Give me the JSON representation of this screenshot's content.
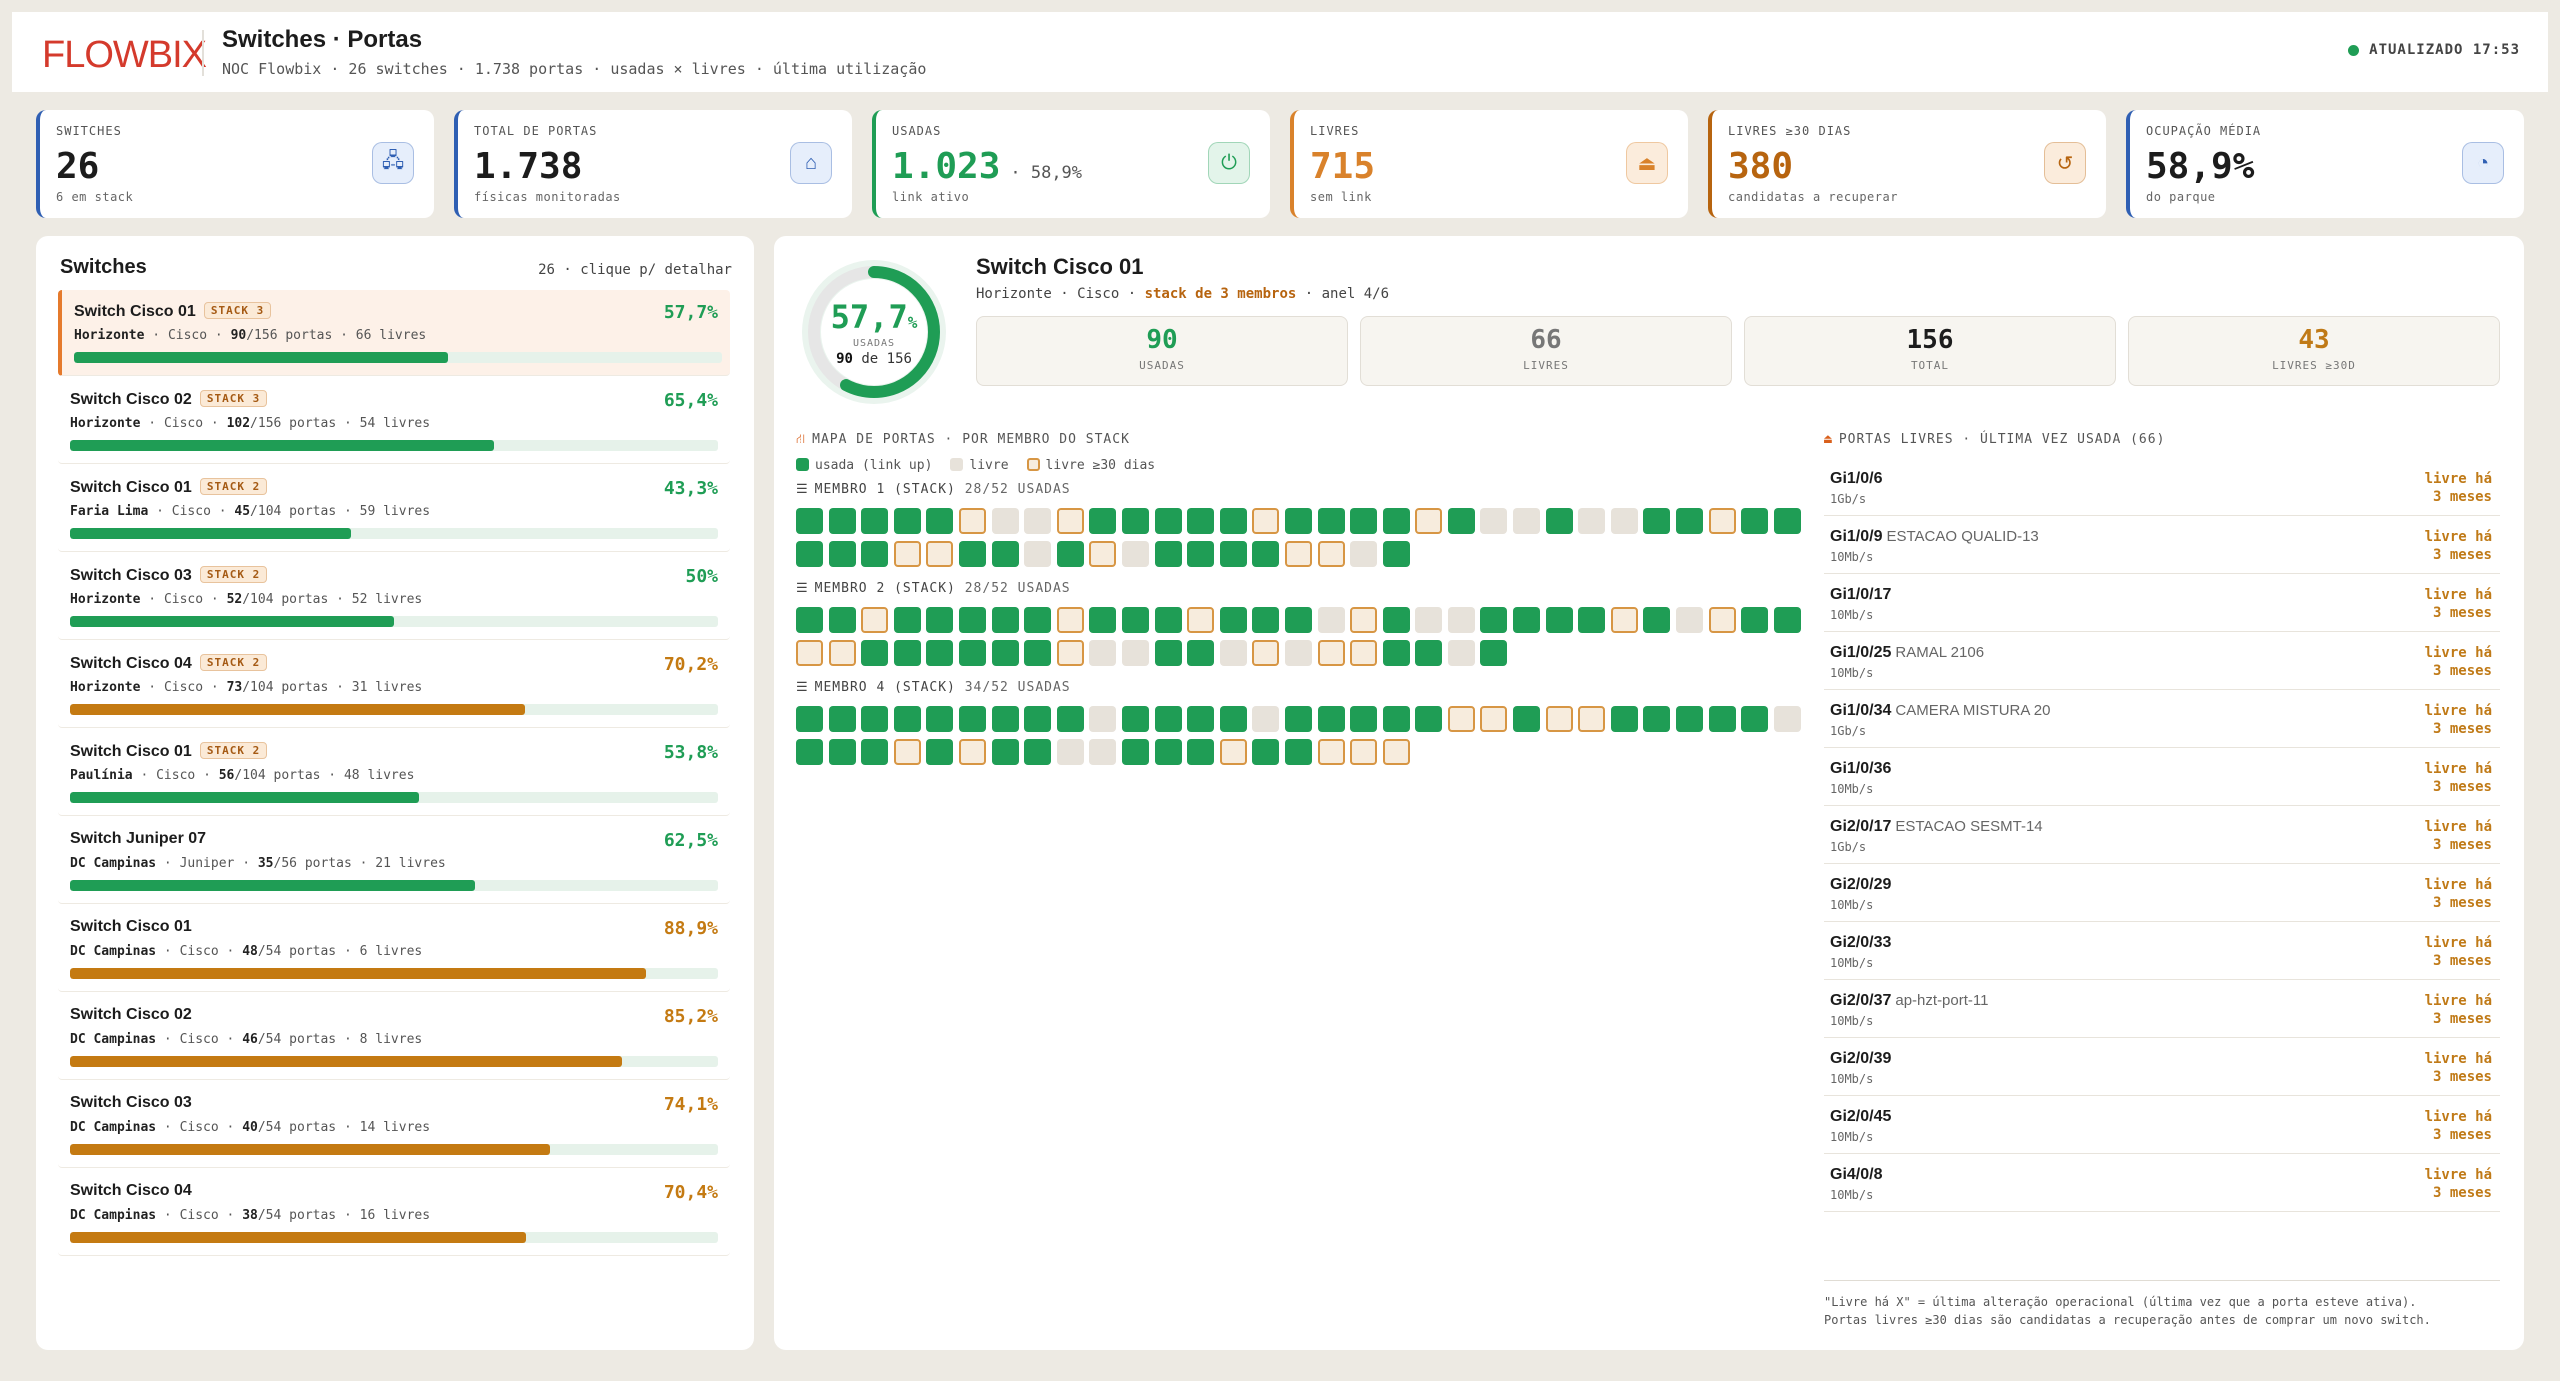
{
  "header": {
    "logo": "FLOWBIX",
    "title": "Switches · Portas",
    "subtitle": "NOC Flowbix · 26 switches · 1.738 portas · usadas × livres · última utilização",
    "updated": "ATUALIZADO 17:53"
  },
  "kpis": [
    {
      "label": "SWITCHES",
      "value": "26",
      "extra": "",
      "sub": "6 em stack",
      "icon": "network-icon",
      "color": "#2f5fb3"
    },
    {
      "label": "TOTAL DE PORTAS",
      "value": "1.738",
      "extra": "",
      "sub": "físicas monitoradas",
      "icon": "ethernet-port-icon",
      "color": "#2f5fb3"
    },
    {
      "label": "USADAS",
      "value": "1.023",
      "extra": "· 58,9%",
      "sub": "link ativo",
      "icon": "plug-icon",
      "color": "#1f9d55"
    },
    {
      "label": "LIVRES",
      "value": "715",
      "extra": "",
      "sub": "sem link",
      "icon": "unplugged-icon",
      "color": "#d9822b"
    },
    {
      "label": "LIVRES ≥30 DIAS",
      "value": "380",
      "extra": "",
      "sub": "candidatas a recuperar",
      "icon": "history-icon",
      "color": "#b7640f"
    },
    {
      "label": "OCUPAÇÃO MÉDIA",
      "value": "58,9%",
      "extra": "",
      "sub": "do parque",
      "icon": "gauge-icon",
      "color": "#2f5fb3"
    }
  ],
  "switch_list": {
    "title": "Switches",
    "hint": "26 · clique p/ detalhar",
    "items": [
      {
        "name": "Switch Cisco 01",
        "stack": "STACK 3",
        "site": "Horizonte",
        "vendor": "Cisco",
        "used": "90",
        "total": "/156 portas",
        "free": "66 livres",
        "pct": "57,7%",
        "fill": 0.577,
        "color": "#1f9d55"
      },
      {
        "name": "Switch Cisco 02",
        "stack": "STACK 3",
        "site": "Horizonte",
        "vendor": "Cisco",
        "used": "102",
        "total": "/156 portas",
        "free": "54 livres",
        "pct": "65,4%",
        "fill": 0.654,
        "color": "#1f9d55"
      },
      {
        "name": "Switch Cisco 01",
        "stack": "STACK 2",
        "site": "Faria Lima",
        "vendor": "Cisco",
        "used": "45",
        "total": "/104 portas",
        "free": "59 livres",
        "pct": "43,3%",
        "fill": 0.433,
        "color": "#1f9d55"
      },
      {
        "name": "Switch Cisco 03",
        "stack": "STACK 2",
        "site": "Horizonte",
        "vendor": "Cisco",
        "used": "52",
        "total": "/104 portas",
        "free": "52 livres",
        "pct": "50%",
        "fill": 0.5,
        "color": "#1f9d55"
      },
      {
        "name": "Switch Cisco 04",
        "stack": "STACK 2",
        "site": "Horizonte",
        "vendor": "Cisco",
        "used": "73",
        "total": "/104 portas",
        "free": "31 livres",
        "pct": "70,2%",
        "fill": 0.702,
        "color": "#c47a12"
      },
      {
        "name": "Switch Cisco 01",
        "stack": "STACK 2",
        "site": "Paulínia",
        "vendor": "Cisco",
        "used": "56",
        "total": "/104 portas",
        "free": "48 livres",
        "pct": "53,8%",
        "fill": 0.538,
        "color": "#1f9d55"
      },
      {
        "name": "Switch Juniper 07",
        "stack": "",
        "site": "DC Campinas",
        "vendor": "Juniper",
        "used": "35",
        "total": "/56 portas",
        "free": "21 livres",
        "pct": "62,5%",
        "fill": 0.625,
        "color": "#1f9d55"
      },
      {
        "name": "Switch Cisco 01",
        "stack": "",
        "site": "DC Campinas",
        "vendor": "Cisco",
        "used": "48",
        "total": "/54 portas",
        "free": "6 livres",
        "pct": "88,9%",
        "fill": 0.889,
        "color": "#c47a12"
      },
      {
        "name": "Switch Cisco 02",
        "stack": "",
        "site": "DC Campinas",
        "vendor": "Cisco",
        "used": "46",
        "total": "/54 portas",
        "free": "8 livres",
        "pct": "85,2%",
        "fill": 0.852,
        "color": "#c47a12"
      },
      {
        "name": "Switch Cisco 03",
        "stack": "",
        "site": "DC Campinas",
        "vendor": "Cisco",
        "used": "40",
        "total": "/54 portas",
        "free": "14 livres",
        "pct": "74,1%",
        "fill": 0.741,
        "color": "#c47a12"
      },
      {
        "name": "Switch Cisco 04",
        "stack": "",
        "site": "DC Campinas",
        "vendor": "Cisco",
        "used": "38",
        "total": "/54 portas",
        "free": "16 livres",
        "pct": "70,4%",
        "fill": 0.704,
        "color": "#c47a12"
      }
    ]
  },
  "detail": {
    "donut_pct": "57,7",
    "donut_pct_unit": "%",
    "donut_fill": 0.577,
    "donut_label": "USADAS",
    "donut_used": "90",
    "donut_of": "de 156",
    "title": "Switch Cisco 01",
    "meta_prefix": "Horizonte · Cisco · ",
    "meta_stack": "stack de 3 membros",
    "meta_suffix": " · anel 4/6",
    "stats": [
      {
        "value": "90",
        "label": "USADAS",
        "color": "#1f9d55"
      },
      {
        "value": "66",
        "label": "LIVRES",
        "color": "#777777"
      },
      {
        "value": "156",
        "label": "TOTAL",
        "color": "#1c1c1c"
      },
      {
        "value": "43",
        "label": "LIVRES ≥30D",
        "color": "#c07a17"
      }
    ],
    "map_title": "MAPA DE PORTAS · POR MEMBRO DO STACK",
    "legend": {
      "used": "usada (link up)",
      "free": "livre",
      "old": "livre ≥30 dias"
    },
    "members": [
      {
        "label": "MEMBRO 1 (STACK)",
        "used": "28/52 USADAS",
        "ports": "UUUUUOFFOUUUUUOUUUUOUFFUFFUUOUUUUUOOUUFUOFUUUUOOFU"
      },
      {
        "label": "MEMBRO 2 (STACK)",
        "used": "28/52 USADAS",
        "ports": "UUOUUUUUOUUUOUUUFOUFFUUUUOUFOUUOOUUUUUUOFFUUFOFOOUUFU"
      },
      {
        "label": "MEMBRO 4 (STACK)",
        "used": "34/52 USADAS",
        "ports": "UUUUUUUUUFUUUUFUUUUUOOUOOUUUUUFUUUOUOUUFFUUUOUUOOO"
      }
    ],
    "free_title": "PORTAS LIVRES · ÚLTIMA VEZ USADA (66)",
    "free_ports": [
      {
        "port": "Gi1/0/6",
        "desc": "",
        "speed": "1Gb/s",
        "age1": "livre há",
        "age2": "3 meses"
      },
      {
        "port": "Gi1/0/9",
        "desc": "ESTACAO QUALID-13",
        "speed": "10Mb/s",
        "age1": "livre há",
        "age2": "3 meses"
      },
      {
        "port": "Gi1/0/17",
        "desc": "",
        "speed": "10Mb/s",
        "age1": "livre há",
        "age2": "3 meses"
      },
      {
        "port": "Gi1/0/25",
        "desc": "RAMAL 2106",
        "speed": "10Mb/s",
        "age1": "livre há",
        "age2": "3 meses"
      },
      {
        "port": "Gi1/0/34",
        "desc": "CAMERA MISTURA 20",
        "speed": "1Gb/s",
        "age1": "livre há",
        "age2": "3 meses"
      },
      {
        "port": "Gi1/0/36",
        "desc": "",
        "speed": "10Mb/s",
        "age1": "livre há",
        "age2": "3 meses"
      },
      {
        "port": "Gi2/0/17",
        "desc": "ESTACAO SESMT-14",
        "speed": "1Gb/s",
        "age1": "livre há",
        "age2": "3 meses"
      },
      {
        "port": "Gi2/0/29",
        "desc": "",
        "speed": "10Mb/s",
        "age1": "livre há",
        "age2": "3 meses"
      },
      {
        "port": "Gi2/0/33",
        "desc": "",
        "speed": "10Mb/s",
        "age1": "livre há",
        "age2": "3 meses"
      },
      {
        "port": "Gi2/0/37",
        "desc": "ap-hzt-port-11",
        "speed": "10Mb/s",
        "age1": "livre há",
        "age2": "3 meses"
      },
      {
        "port": "Gi2/0/39",
        "desc": "",
        "speed": "10Mb/s",
        "age1": "livre há",
        "age2": "3 meses"
      },
      {
        "port": "Gi2/0/45",
        "desc": "",
        "speed": "10Mb/s",
        "age1": "livre há",
        "age2": "3 meses"
      },
      {
        "port": "Gi4/0/8",
        "desc": "",
        "speed": "10Mb/s",
        "age1": "livre há",
        "age2": "3 meses"
      }
    ],
    "footnote1": "\"Livre há X\" = última alteração operacional (última vez que a porta esteve ativa).",
    "footnote2": "Portas livres ≥30 dias são candidatas a recuperação antes de comprar um novo switch."
  }
}
